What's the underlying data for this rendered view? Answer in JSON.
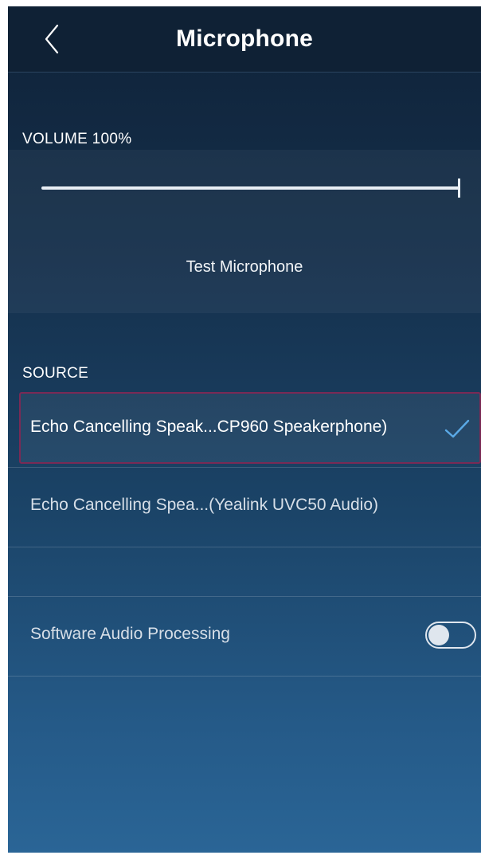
{
  "header": {
    "title": "Microphone",
    "back_icon": "chevron-left-icon"
  },
  "volume": {
    "label": "VOLUME 100%",
    "level_percent": 100,
    "test_label": "Test Microphone"
  },
  "source": {
    "label": "SOURCE",
    "items": [
      {
        "label": "Echo Cancelling Speak...CP960 Speakerphone)",
        "selected": true
      },
      {
        "label": "Echo Cancelling Spea...(Yealink UVC50 Audio)",
        "selected": false
      }
    ]
  },
  "settings": {
    "software_audio_processing": {
      "label": "Software Audio Processing",
      "enabled": false
    }
  },
  "colors": {
    "accent_check": "#5aa9e6",
    "selected_border": "#7a2a55"
  }
}
